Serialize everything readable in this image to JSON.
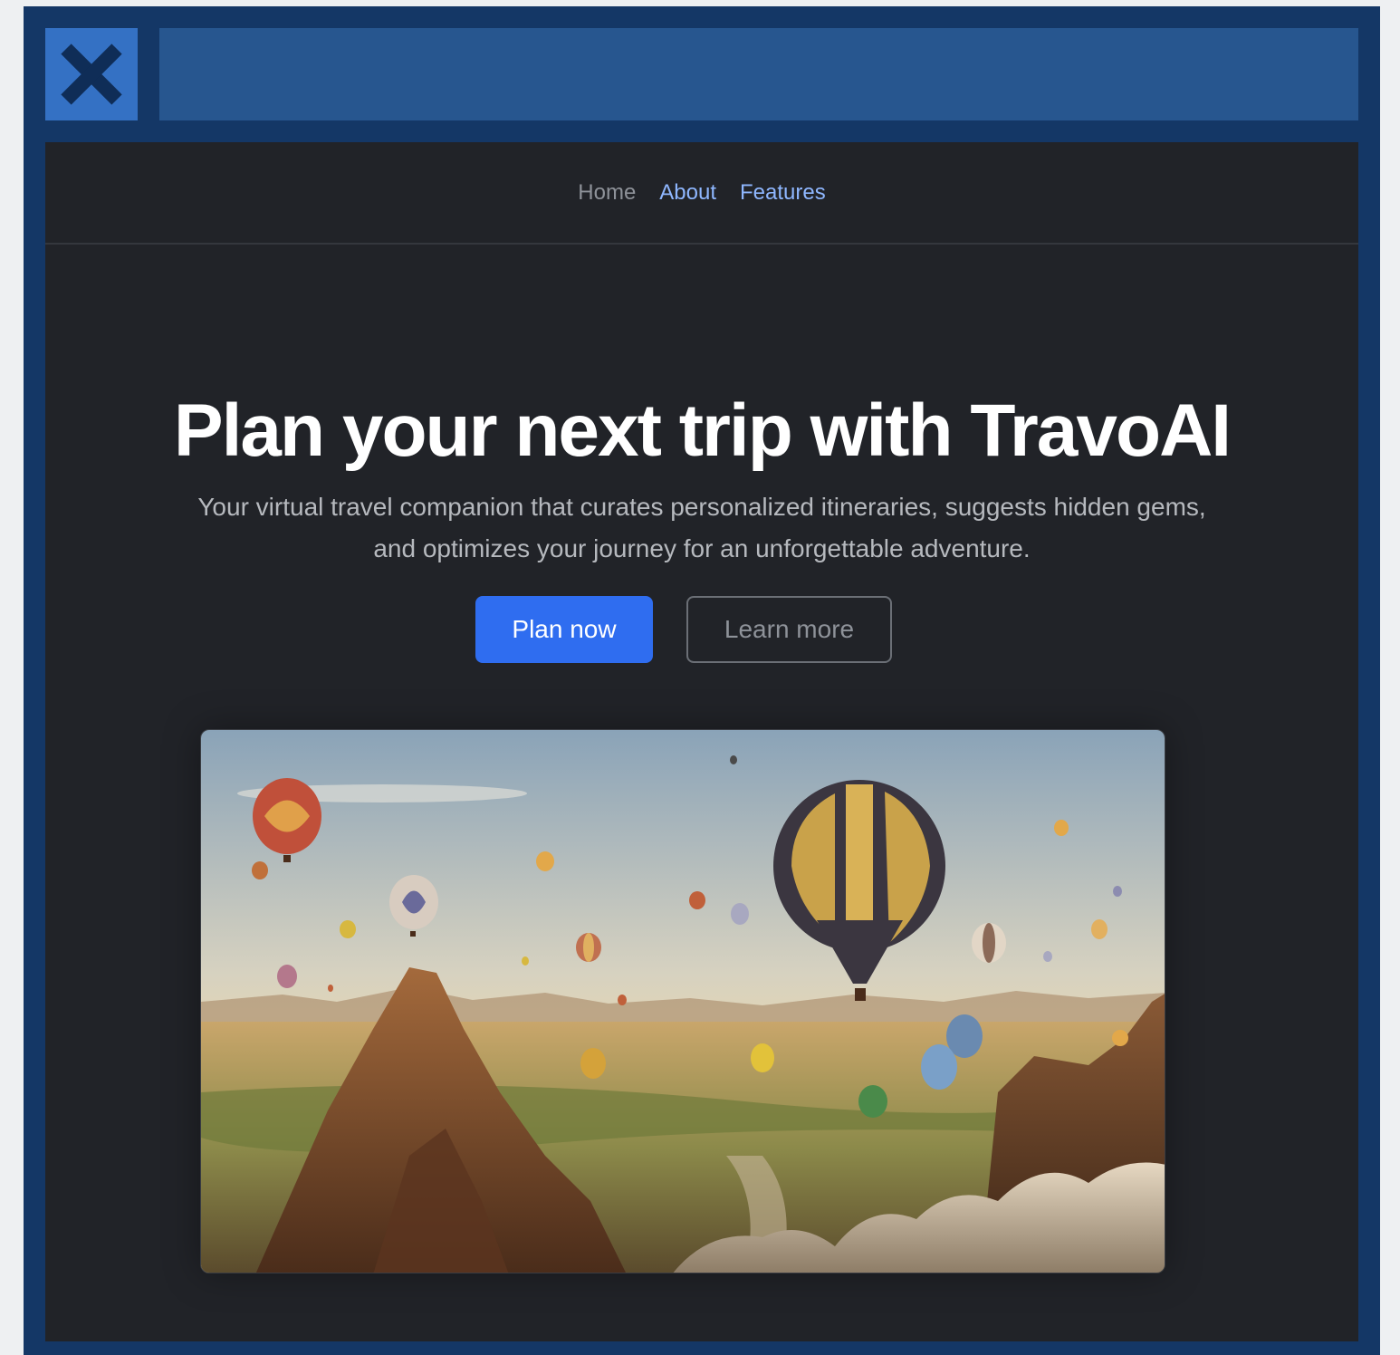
{
  "nav": {
    "home": "Home",
    "about": "About",
    "features": "Features"
  },
  "hero": {
    "title": "Plan your next trip with TravoAI",
    "subtitle": "Your virtual travel companion that curates personalized itineraries, suggests hidden gems, and optimizes your journey for an unforgettable adventure.",
    "primary_button": "Plan now",
    "secondary_button": "Learn more"
  },
  "colors": {
    "frame": "#143766",
    "close_box": "#3471c4",
    "title_bar": "#27568f",
    "page_bg": "#212328",
    "accent": "#2f6df0",
    "nav_active": "#8fb7ff"
  },
  "icons": {
    "close": "close-icon"
  }
}
